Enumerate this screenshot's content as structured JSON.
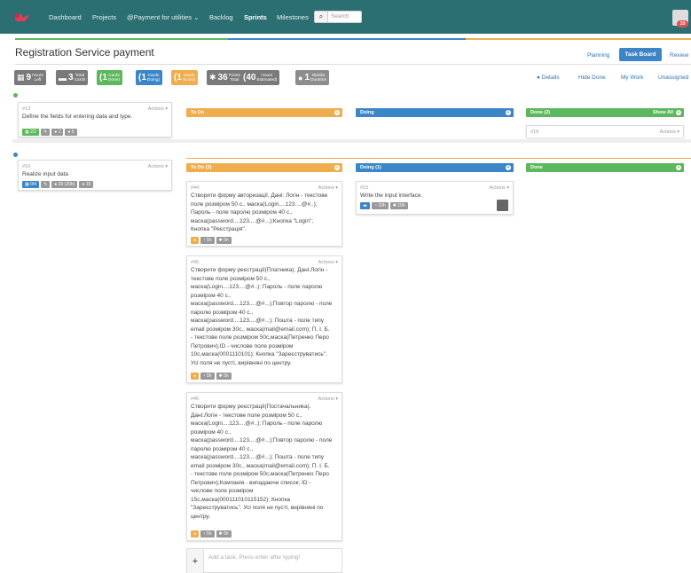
{
  "nav": {
    "items": [
      "Dashboard",
      "Projects",
      "@Payment for utilities",
      "Backlog",
      "Sprints",
      "Milestones"
    ],
    "search_placeholder": "Search",
    "notif_count": "10"
  },
  "page": {
    "title": "Registration Service payment"
  },
  "tabs": {
    "planning": "Planning",
    "task_board": "Task Board",
    "review": "Review"
  },
  "stats": [
    {
      "num": "9",
      "label1": "Hours",
      "label2": "Left"
    },
    {
      "num": "3",
      "label1": "Total",
      "label2": "Cards"
    },
    {
      "num": "(1",
      "label1": "Cards",
      "label2": "Done)"
    },
    {
      "num": "(1",
      "label1": "Cards",
      "label2": "Doing)"
    },
    {
      "num": "(1",
      "label1": "Cards",
      "label2": "To Do)"
    },
    {
      "num": "36",
      "label1": "Points",
      "label2": "Total"
    },
    {
      "num": "(40",
      "label1": "Hours",
      "label2": "Estimated)"
    },
    {
      "num": "1",
      "label1": "Weeks",
      "label2": "Duration"
    }
  ],
  "filters": {
    "details": "Details",
    "hide_done": "Hide Done",
    "my_work": "My Work",
    "unassigned": "Unassigned"
  },
  "lane1": {
    "story": {
      "num": "#13",
      "actions": "Actions",
      "text": "Define the fields for entering data and type.",
      "tags": [
        "2/2",
        "",
        "1",
        "5"
      ]
    },
    "cols": {
      "todo": "To Do",
      "doing": "Doing",
      "done": "Done (2)",
      "show_all": "Show All"
    },
    "done_card": {
      "num": "#19",
      "actions": "Actions"
    }
  },
  "lane2": {
    "story": {
      "num": "#10",
      "actions": "Actions",
      "text": "Realize input data",
      "tags": [
        "0/4",
        "",
        "20 (20h)",
        "10"
      ]
    },
    "cols": {
      "todo": "To Do (3)",
      "doing": "Doing (1)",
      "done": "Done"
    },
    "todo_cards": [
      {
        "num": "#44",
        "actions": "Actions",
        "lines": [
          "Створити форму авторизації. Дані: Логін - текстове",
          "поле розміром 50 с., маска(Login....123....@#..);",
          "Пароль - поле паролю розміром 40 с.,",
          "маска(password....123....@#...);Кнопка \"Login\";",
          "Кнопка \"Реєстрація\"."
        ],
        "tags": [
          "5h",
          "5h"
        ]
      },
      {
        "num": "#45",
        "actions": "Actions",
        "lines": [
          "Створити форму реєстрації(Платника). Дані:Логін -",
          "текстове поле розміром 50 с.,",
          "маска(Login....123....@#..); Пароль - поле паролю",
          "розміром 40 с.,",
          "маска(password....123....@#...);Повтор паролю - поле",
          "паролю розміром 40 с.,",
          "маска(password....123....@#...); Пошта - поле типу",
          "email розміром 30с., маска(mail@email.com); П. І. Б.",
          "- текстове поле розміром 50с,маска(Петренко Перо",
          "Петрович);ID - числове поле розміром",
          "10с,маска(0001110101); Кнопка \"Зареєструватись\".",
          "Усі поля не пусті, вирівняні по центру."
        ],
        "tags": [
          "5h",
          "5h"
        ]
      },
      {
        "num": "#46",
        "actions": "Actions",
        "lines": [
          "Створити форму реєстрації(Постачальника).",
          "Дані:Логін - текстове поле розміром 50 с.,",
          "маска(Login....123....@#..); Пароль - поле паролю",
          "розміром 40 с.,",
          "маска(password....123....@#...);Повтор паролю - поле",
          "паролю розміром 40 с.,",
          "маска(password....123....@#...); Пошта - поле типу",
          "email розміром 30с., маска(mail@email.com); П. І. Б.",
          "- текстове поле розміром 50с,маска(Петренко Перо",
          "Петрович);Компанія - випадаючи список; ID -",
          "числове поле розміром",
          "15с,маска(000111010115152); Кнопка",
          "\"Зареєструватись\". Усі поля не пусті, вирівняні по",
          "центру."
        ],
        "tags": [
          "5h",
          "5h"
        ]
      }
    ],
    "doing_card": {
      "num": "#15",
      "actions": "Actions",
      "text": "Write the input interface.",
      "tags": [
        "10h",
        "10h"
      ]
    },
    "add_placeholder": "Add a task. Press enter after typing!"
  }
}
